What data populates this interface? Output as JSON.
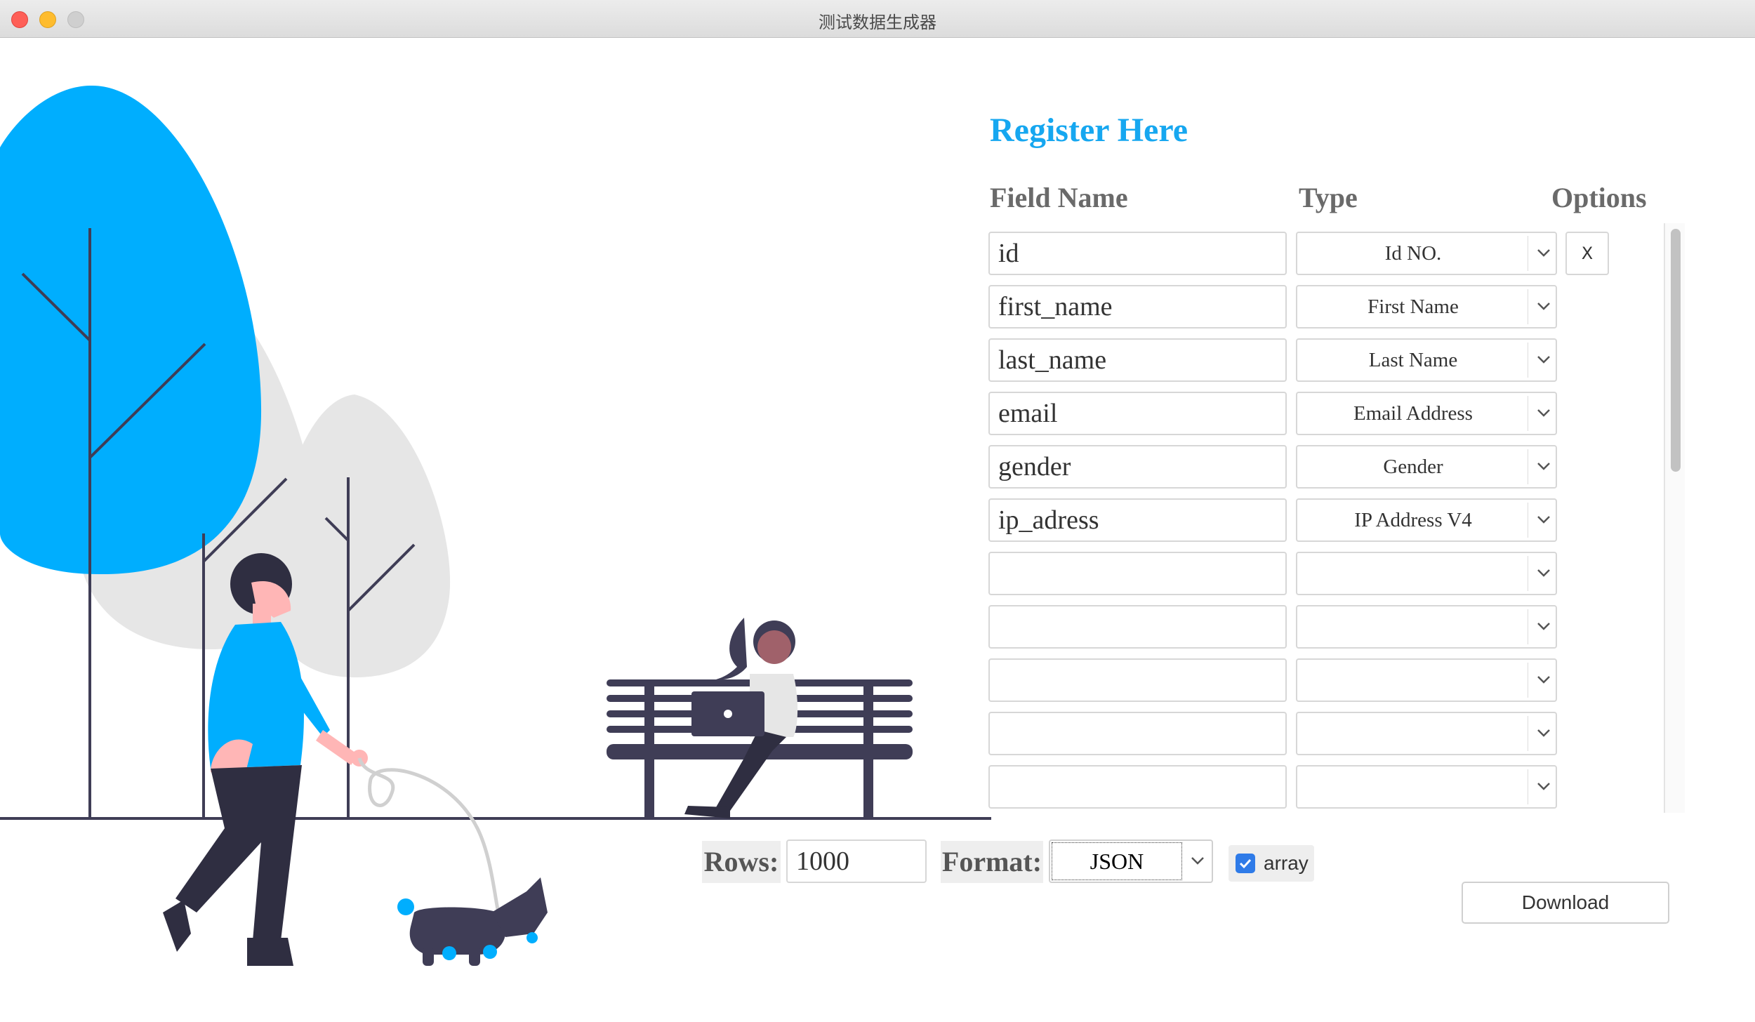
{
  "window": {
    "title": "测试数据生成器"
  },
  "form": {
    "title": "Register Here",
    "headers": {
      "field_name": "Field Name",
      "type": "Type",
      "options": "Options"
    },
    "remove_label": "X",
    "rows": [
      {
        "field": "id",
        "type": "Id NO."
      },
      {
        "field": "first_name",
        "type": "First Name"
      },
      {
        "field": "last_name",
        "type": "Last Name"
      },
      {
        "field": "email",
        "type": "Email Address"
      },
      {
        "field": "gender",
        "type": "Gender"
      },
      {
        "field": "ip_adress",
        "type": "IP Address V4"
      },
      {
        "field": "",
        "type": ""
      },
      {
        "field": "",
        "type": ""
      },
      {
        "field": "",
        "type": ""
      },
      {
        "field": "",
        "type": ""
      },
      {
        "field": "",
        "type": ""
      }
    ]
  },
  "controls": {
    "rows_label": "Rows:",
    "rows_value": "1000",
    "format_label": "Format:",
    "format_value": "JSON",
    "array_label": "array",
    "array_checked": true,
    "download_label": "Download"
  },
  "colors": {
    "accent": "#16a7f0",
    "tree_blue": "#00aefe",
    "tree_gray": "#e6e6e6",
    "dark": "#3f3d56",
    "skin": "#ffb6b6",
    "title_text": "#16a7f0"
  }
}
